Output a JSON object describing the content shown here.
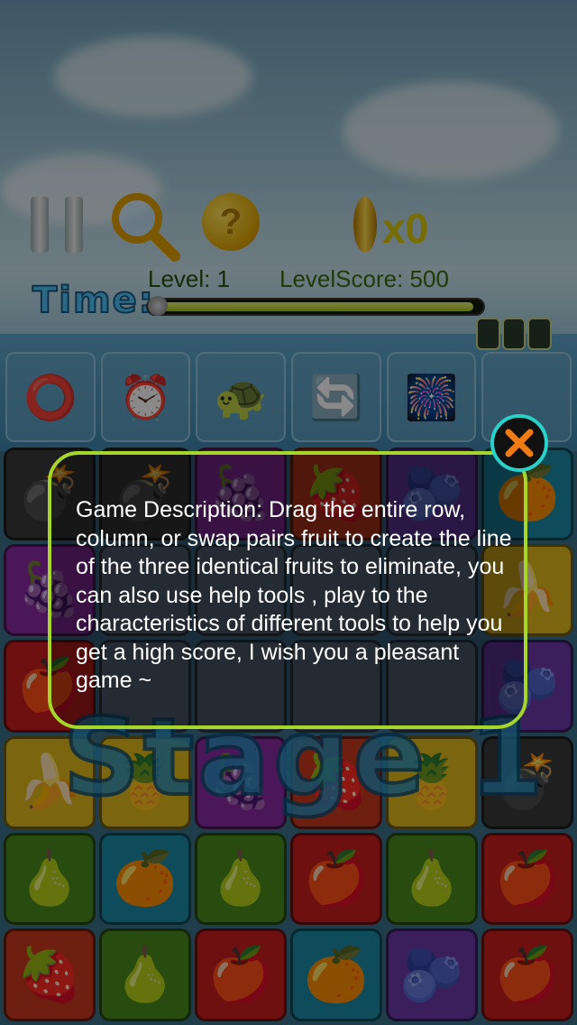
{
  "hud": {
    "coin_question": "?",
    "coin_count": "x0",
    "level_label": "Level:  1",
    "levelscore_label": "LevelScore: 500",
    "time_label": "Time:",
    "time_fraction": 0.98
  },
  "tools": [
    {
      "icon": "ring-icon",
      "glyph": "⭕"
    },
    {
      "icon": "alarm-clock-icon",
      "glyph": "⏰"
    },
    {
      "icon": "turtle-fruit-basket-icon",
      "glyph": "🐢"
    },
    {
      "icon": "refresh-arrows-icon",
      "glyph": "🔄"
    },
    {
      "icon": "fireworks-icon",
      "glyph": "🎆"
    },
    {
      "icon": "empty-slot",
      "glyph": ""
    }
  ],
  "board": [
    [
      "bomb",
      "bomb",
      "grape",
      "strawberry",
      "plum",
      "orange"
    ],
    [
      "grape",
      "cell",
      "cell",
      "cell",
      "cell",
      "banana"
    ],
    [
      "apple",
      "cell",
      "cell",
      "cell",
      "cell",
      "plum"
    ],
    [
      "banana",
      "pineapple",
      "grape",
      "strawberry",
      "pineapple",
      "bomb"
    ],
    [
      "pear",
      "orange",
      "pear",
      "apple",
      "pear",
      "apple"
    ],
    [
      "strawberry",
      "pear",
      "apple",
      "orange",
      "plum",
      "apple"
    ]
  ],
  "stage_text": "Stage 1",
  "dialog": {
    "text": "Game Description: Drag the entire row, column, or swap pairs fruit to create the line of the three identical fruits to eliminate, you can also use help tools , play to the characteristics of different tools to help you get a high score, I wish you a pleasant game ~",
    "close_icon": "close-icon"
  },
  "colors": {
    "dialog_border": "#a7d62a",
    "close_ring": "#29d1c9",
    "close_x": "#f07b12"
  }
}
